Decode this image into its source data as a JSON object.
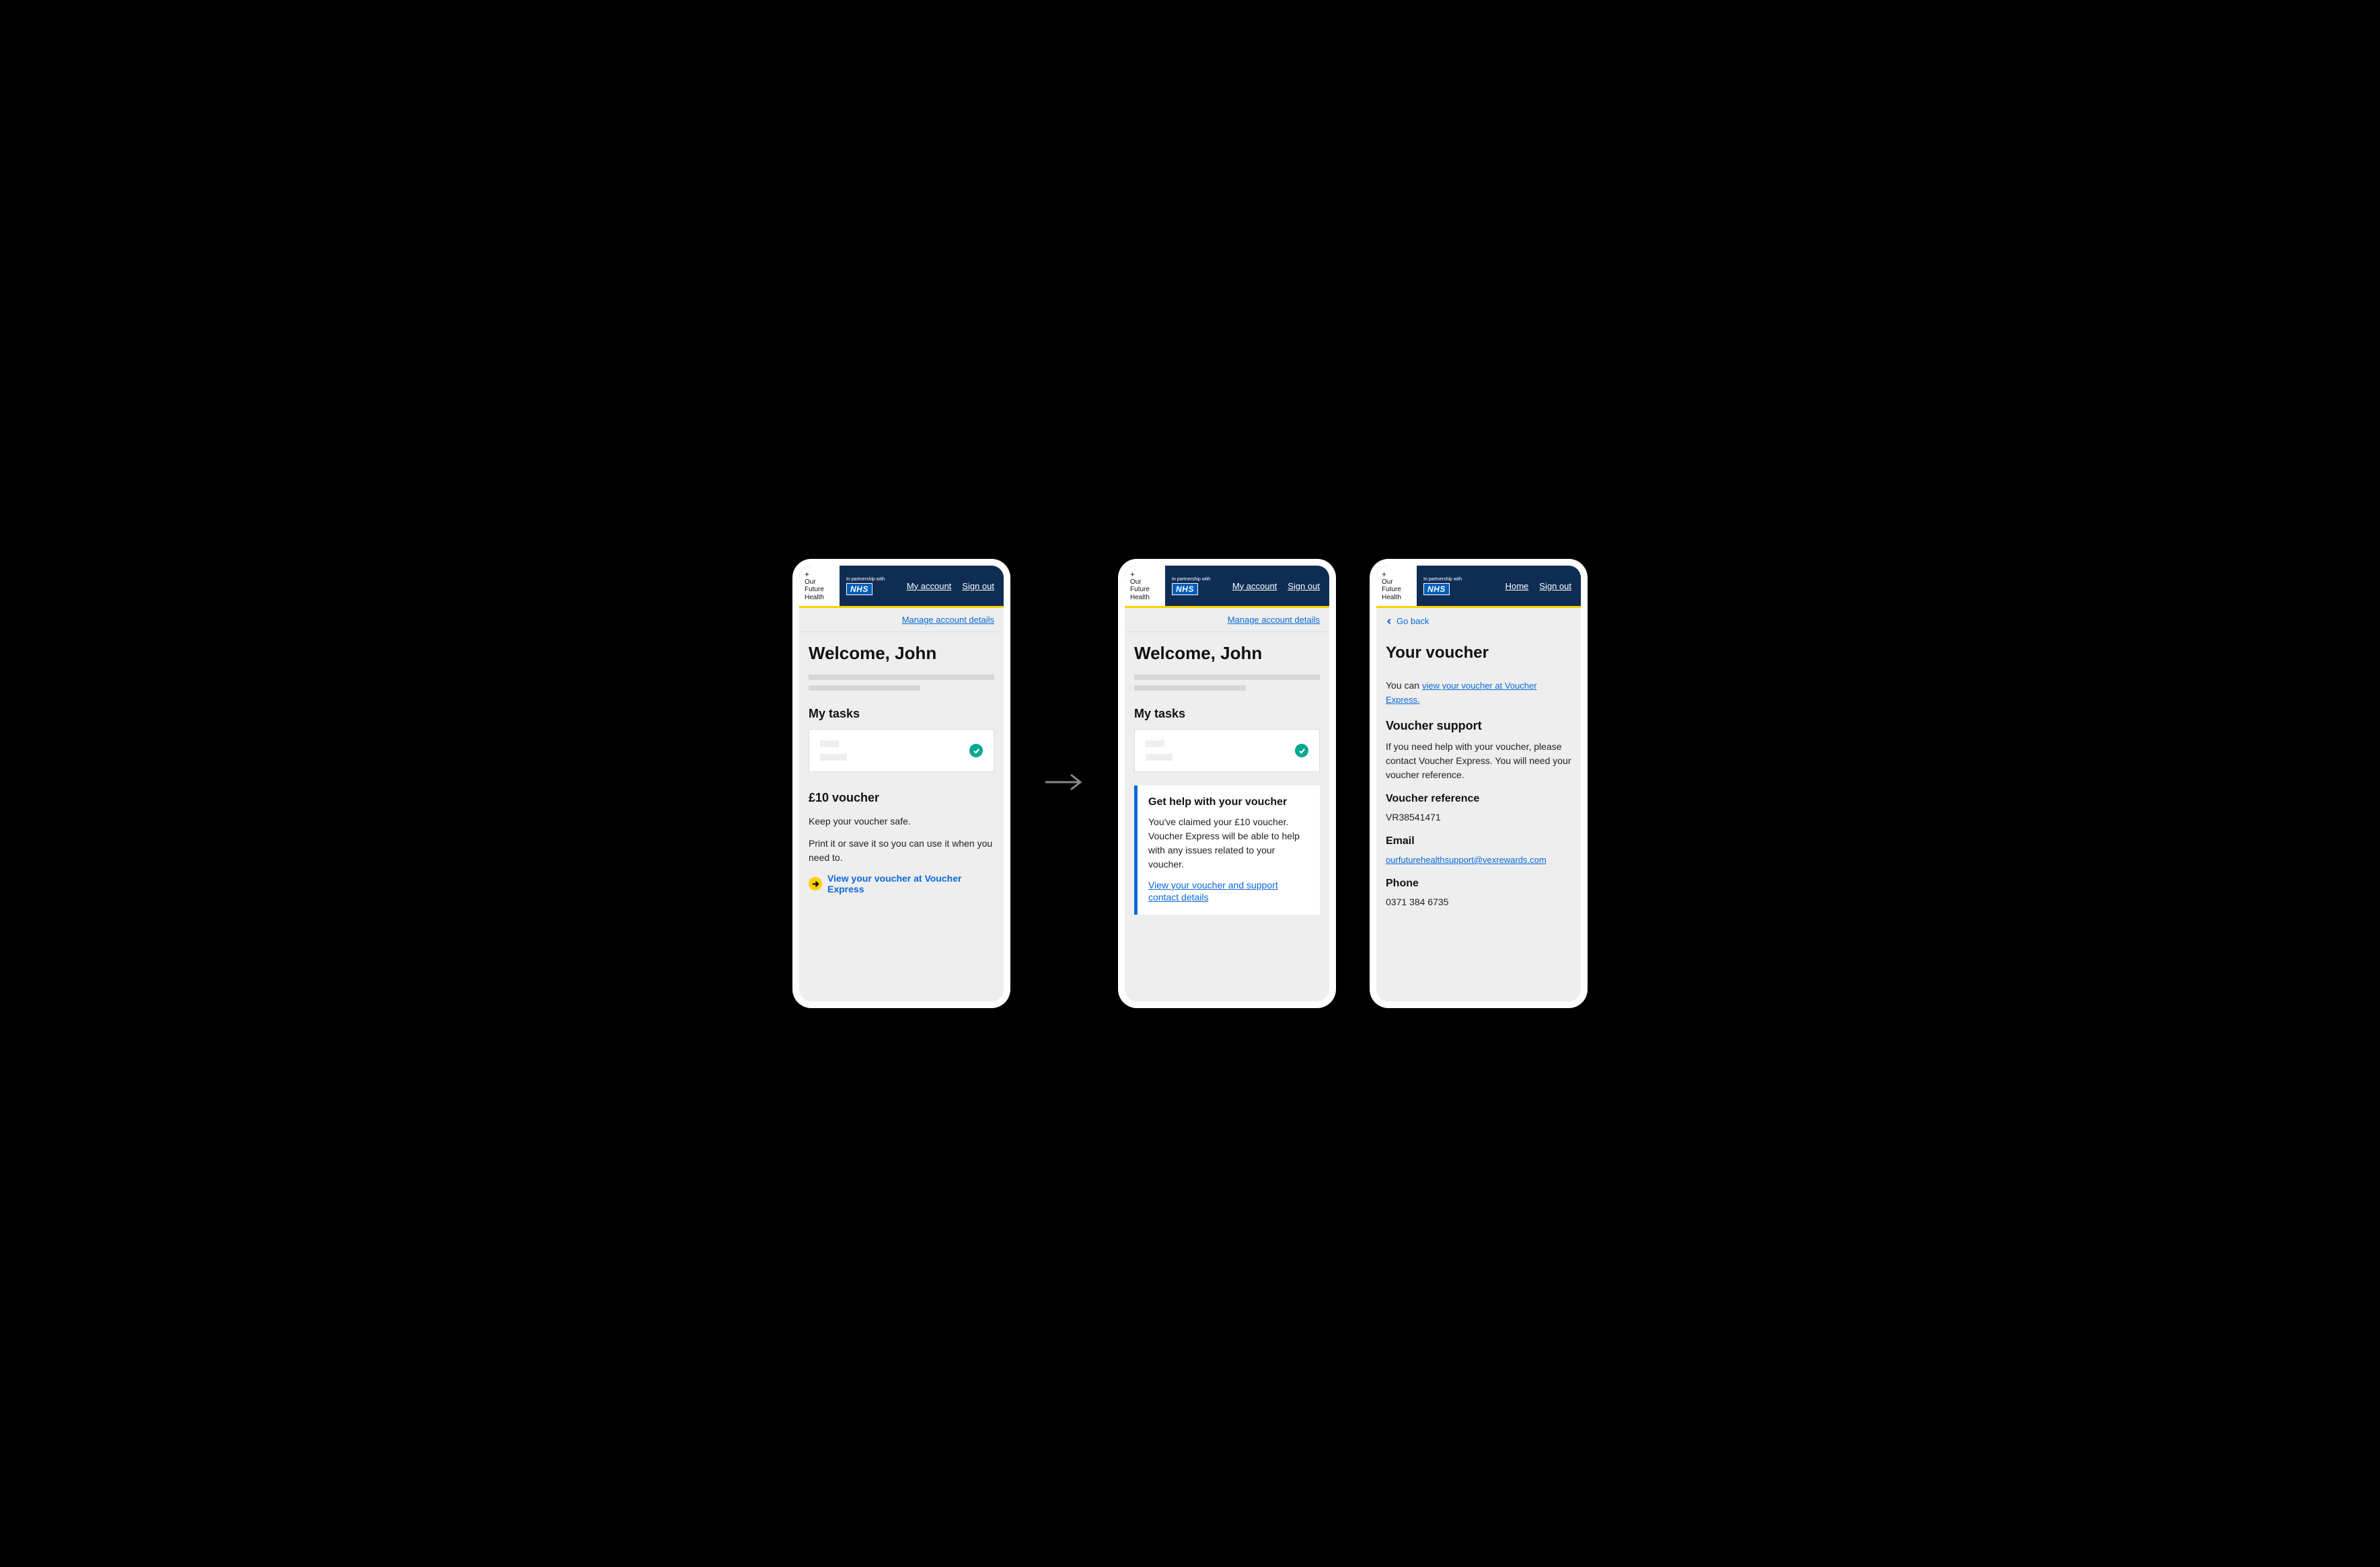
{
  "header": {
    "logo_lines": "Our\nFuture\nHealth",
    "partnership_label": "In partnership with",
    "nhs_label": "NHS",
    "nav": {
      "my_account": "My account",
      "sign_out": "Sign out",
      "home": "Home"
    }
  },
  "manage_link": "Manage account details",
  "welcome_heading": "Welcome, John",
  "my_tasks_heading": "My tasks",
  "screen1": {
    "voucher_heading": "£10 voucher",
    "line1": "Keep your voucher safe.",
    "line2": "Print it or save it so you can use it when you need to.",
    "cta": "View your voucher at Voucher Express"
  },
  "screen2": {
    "panel_title": "Get help with your voucher",
    "panel_body": "You've claimed your £10 voucher. Voucher Express will be able to help with any issues related to your voucher.",
    "panel_link": "View your voucher and support contact details"
  },
  "screen3": {
    "go_back": "Go back",
    "heading": "Your voucher",
    "intro_prefix": "You can ",
    "intro_link": "view your voucher at Voucher Express.",
    "support_heading": "Voucher support",
    "support_body": "If you need help with your voucher, please contact Voucher Express. You will need your voucher reference.",
    "ref_heading": "Voucher reference",
    "ref_value": "VR38541471",
    "email_heading": "Email",
    "email_value": "ourfuturehealthsupport@vexrewards.com",
    "phone_heading": "Phone",
    "phone_value": "0371 384 6735"
  }
}
